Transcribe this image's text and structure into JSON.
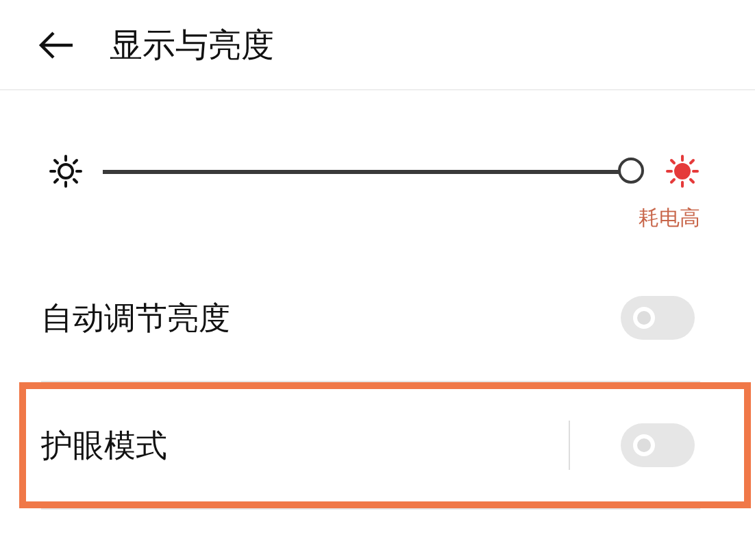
{
  "header": {
    "title": "显示与亮度"
  },
  "brightness": {
    "level": 1.0,
    "warning": "耗电高"
  },
  "settings": [
    {
      "kind": "switch",
      "label": "自动调节亮度",
      "on": false,
      "highlighted": false
    },
    {
      "kind": "switch-divided",
      "label": "护眼模式",
      "on": false,
      "highlighted": true
    }
  ]
}
